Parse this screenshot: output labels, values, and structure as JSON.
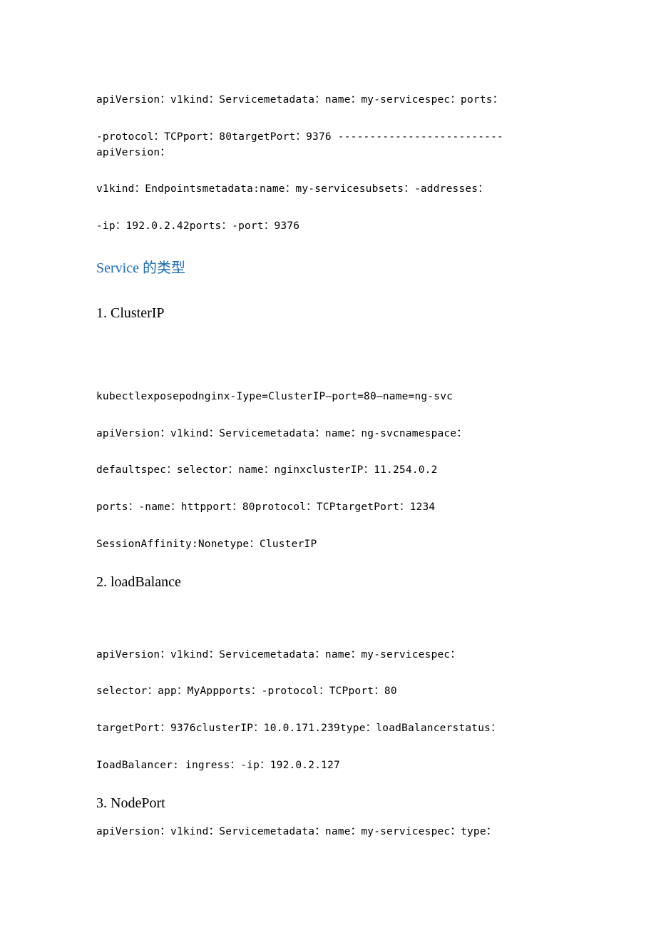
{
  "lines": {
    "l1": "apiVersion：v1kind：Servicemetadata：name：my-servicespec：ports：",
    "l2": "-protocol：TCPport：80targetPort：9376 --------------------------apiVersion：",
    "l3": "v1kind：Endpointsmetadata:name：my-servicesubsets：-addresses：",
    "l4": "-ip：192.0.2.42ports：-port：9376",
    "l5": "kubectlexposepodnginx-Iype=ClusterIP—port=80—name=ng-svc",
    "l6": "apiVersion：v1kind：Servicemetadata：name：ng-svcnamespace：",
    "l7": "defaultspec：selector：name：nginxclusterIP：11.254.0.2",
    "l8": "ports：-name：httpport：80protocol：TCPtargetPort：1234",
    "l9": "SessionAffinity:Nonetype：ClusterIP",
    "l10": "apiVersion：v1kind：Servicemetadata：name：my-servicespec：",
    "l11": "selector：app：MyAppports：-protocol：TCPport：80",
    "l12": "targetPort：9376clusterIP：10.0.171.239type：loadBalancerstatus：",
    "l13": "IoadBalancer:       ingress：-ip：192.0.2.127",
    "l14": "apiVersion：v1kind：Servicemetadata：name：my-servicespec：type："
  },
  "headings": {
    "serviceTypes": "Service 的类型",
    "h1": "1.  ClusterIP",
    "h2": "2.  loadBalance",
    "h3": "3.  NodePort"
  }
}
